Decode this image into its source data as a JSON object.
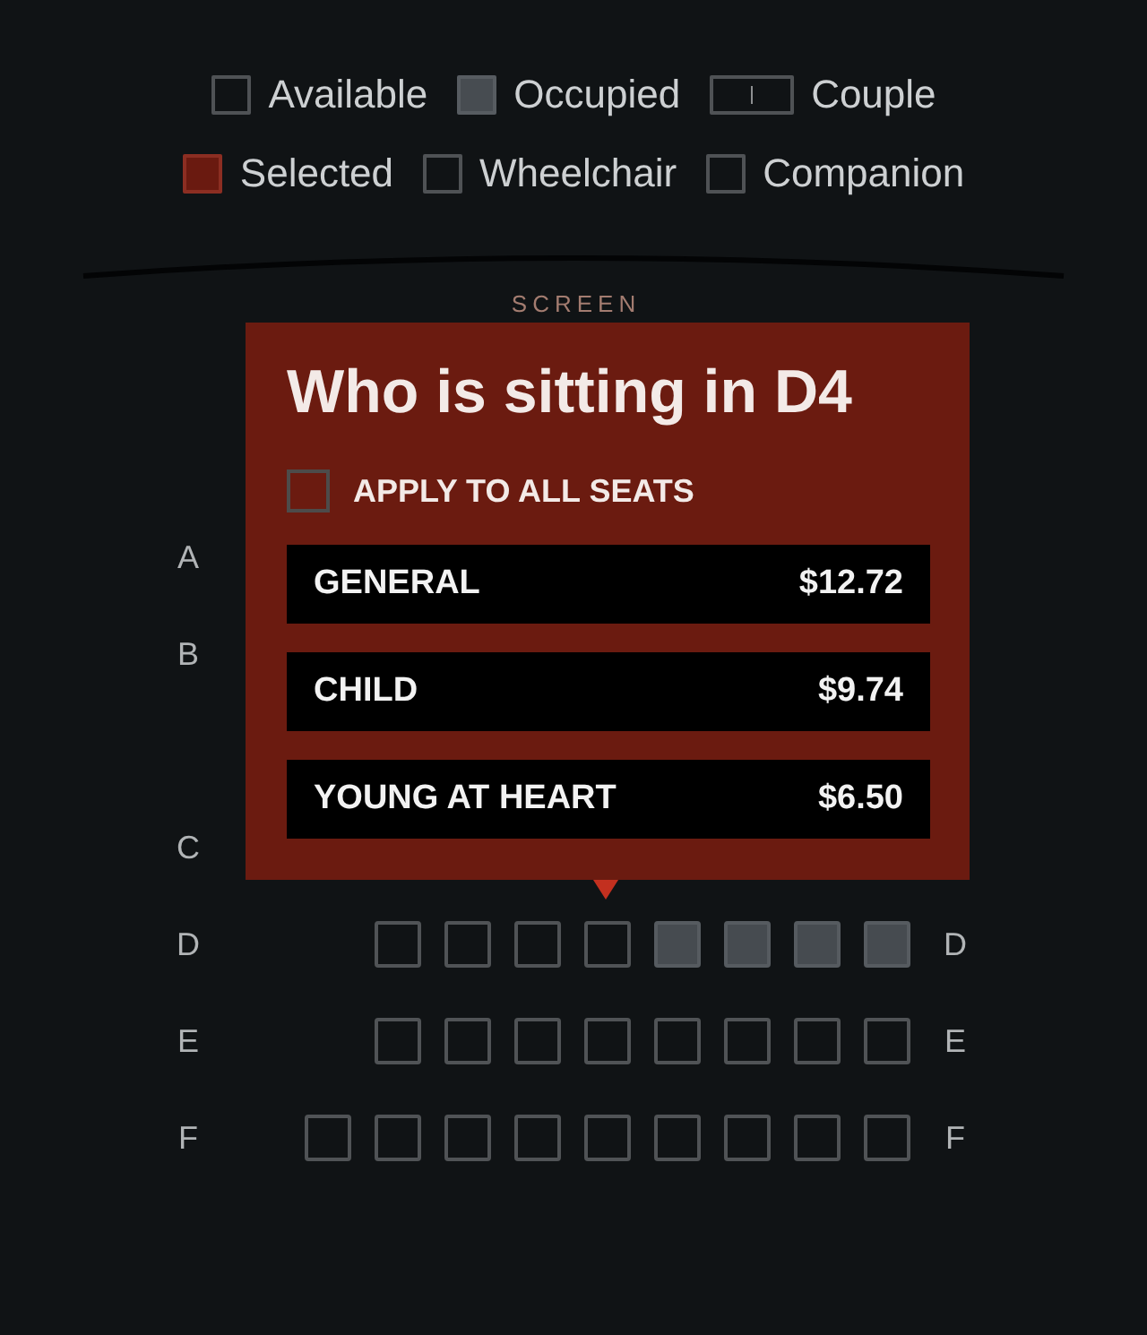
{
  "legend": [
    {
      "kind": "available",
      "label": "Available"
    },
    {
      "kind": "occupied",
      "label": "Occupied"
    },
    {
      "kind": "couple",
      "label": "Couple"
    },
    {
      "kind": "selected",
      "label": "Selected"
    },
    {
      "kind": "wheelchair",
      "label": "Wheelchair"
    },
    {
      "kind": "companion",
      "label": "Companion"
    }
  ],
  "screen": {
    "label": "SCREEN"
  },
  "seat_map": {
    "rows": [
      {
        "kind": "row",
        "label": "A"
      },
      {
        "kind": "row",
        "label": "B"
      },
      {
        "kind": "aisle"
      },
      {
        "kind": "row",
        "label": "C"
      },
      {
        "kind": "row",
        "label": "D",
        "right_label": "D",
        "seats": [
          {
            "occupied": false
          },
          {
            "occupied": false
          },
          {
            "occupied": false
          },
          {
            "occupied": false
          },
          {
            "occupied": true
          },
          {
            "occupied": true
          },
          {
            "occupied": true
          },
          {
            "occupied": true
          }
        ]
      },
      {
        "kind": "row",
        "label": "E",
        "right_label": "E",
        "seats": [
          {
            "occupied": false
          },
          {
            "occupied": false
          },
          {
            "occupied": false
          },
          {
            "occupied": false
          },
          {
            "occupied": false
          },
          {
            "occupied": false
          },
          {
            "occupied": false
          },
          {
            "occupied": false
          }
        ]
      },
      {
        "kind": "row",
        "label": "F",
        "right_label": "F",
        "seats": [
          {
            "occupied": false
          },
          {
            "occupied": false
          },
          {
            "occupied": false
          },
          {
            "occupied": false
          },
          {
            "occupied": false
          },
          {
            "occupied": false
          },
          {
            "occupied": false
          },
          {
            "occupied": false
          },
          {
            "occupied": false
          }
        ]
      }
    ]
  },
  "popup": {
    "title": "Who is sitting in D4",
    "apply_all": {
      "label": "APPLY TO ALL SEATS",
      "checked": false
    },
    "ticket_types": [
      {
        "label": "GENERAL",
        "price": "$12.72"
      },
      {
        "label": "CHILD",
        "price": "$9.74"
      },
      {
        "label": "YOUNG AT HEART",
        "price": "$6.50"
      }
    ]
  }
}
